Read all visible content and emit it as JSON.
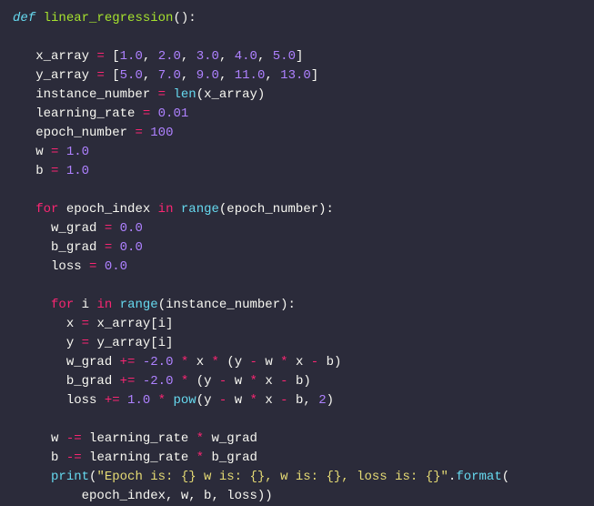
{
  "code": {
    "line1": {
      "def": "def",
      "func": "linear_regression",
      "parens": "():",
      "blank": ""
    },
    "line3": {
      "var": "x_array",
      "eq": "=",
      "val": "[1.0, 2.0, 3.0, 4.0, 5.0]"
    },
    "line4": {
      "var": "y_array",
      "eq": "=",
      "val": "[5.0, 7.0, 9.0, 11.0, 13.0]"
    },
    "line5": {
      "var": "instance_number",
      "eq": "=",
      "func": "len",
      "arg": "(x_array)"
    },
    "line6": {
      "var": "learning_rate",
      "eq": "=",
      "val": "0.01"
    },
    "line7": {
      "var": "epoch_number",
      "eq": "=",
      "val": "100"
    },
    "line8": {
      "var": "w",
      "eq": "=",
      "val": "1.0"
    },
    "line9": {
      "var": "b",
      "eq": "=",
      "val": "1.0"
    },
    "line11": {
      "for": "for",
      "var": "epoch_index",
      "in": "in",
      "func": "range",
      "arg": "(epoch_number):"
    },
    "line12": {
      "var": "w_grad",
      "eq": "=",
      "val": "0.0"
    },
    "line13": {
      "var": "b_grad",
      "eq": "=",
      "val": "0.0"
    },
    "line14": {
      "var": "loss",
      "eq": "=",
      "val": "0.0"
    },
    "line16": {
      "for": "for",
      "var": "i",
      "in": "in",
      "func": "range",
      "arg": "(instance_number):"
    },
    "line17": {
      "var": "x",
      "eq": "=",
      "rhs": "x_array[i]"
    },
    "line18": {
      "var": "y",
      "eq": "=",
      "rhs": "y_array[i]"
    },
    "line19": {
      "var": "w_grad",
      "op": "+=",
      "neg": "-2.0",
      "mul": "*",
      "x": "x",
      "y": "y",
      "w": "w",
      "b": "b",
      "minus": "-"
    },
    "line20": {
      "var": "b_grad",
      "op": "+=",
      "neg": "-2.0",
      "mul": "*",
      "y": "y",
      "w": "w",
      "x": "x",
      "b": "b",
      "minus": "-"
    },
    "line21": {
      "var": "loss",
      "op": "+=",
      "one": "1.0",
      "mul": "*",
      "pow": "pow",
      "y": "y",
      "w": "w",
      "x": "x",
      "b": "b",
      "minus": "-",
      "two": "2"
    },
    "line23": {
      "var": "w",
      "op": "-=",
      "lr": "learning_rate",
      "mul": "*",
      "grad": "w_grad"
    },
    "line24": {
      "var": "b",
      "op": "-=",
      "lr": "learning_rate",
      "mul": "*",
      "grad": "b_grad"
    },
    "line25": {
      "print": "print",
      "str": "\"Epoch is: {} w is: {}, w is: {}, loss is: {}\"",
      "format": "format",
      "args": "epoch_index, w, b, loss))"
    }
  }
}
